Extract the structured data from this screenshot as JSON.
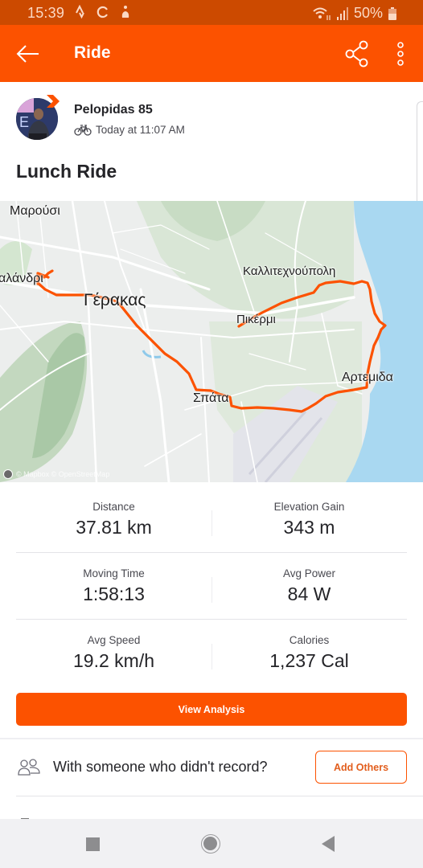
{
  "status_bar": {
    "time": "15:39",
    "battery": "50%",
    "left_icons": [
      "strava-notification-icon",
      "sync-icon",
      "accessibility-icon"
    ],
    "right_icons": [
      "wifi-icon",
      "signal-icon",
      "battery-icon"
    ]
  },
  "app_bar": {
    "title": "Ride",
    "back_icon": "arrow-left-icon",
    "share_icon": "share-icon",
    "more_icon": "more-vertical-icon"
  },
  "activity": {
    "athlete_name": "Pelopidas 85",
    "sport_icon": "bike-icon",
    "timestamp": "Today at 11:07 AM",
    "title": "Lunch Ride"
  },
  "map": {
    "labels": {
      "marousi": "Μαρούσι",
      "chalandri": "αλάνδρι",
      "gerakas": "Γέρακας",
      "kallitechnoupoli": "Καλλιτεχνούπολη",
      "pikermi": "Πικέρμι",
      "spata": "Σπάτα",
      "artemida": "Αρτεμιδα"
    },
    "attribution": "© Mapbox © OpenStreetMap",
    "route_color": "#fc5200",
    "water_color": "#a9d8f1"
  },
  "stats": [
    {
      "label": "Distance",
      "value": "37.81 km"
    },
    {
      "label": "Elevation Gain",
      "value": "343 m"
    },
    {
      "label": "Moving Time",
      "value": "1:58:13"
    },
    {
      "label": "Avg Power",
      "value": "84 W"
    },
    {
      "label": "Avg Speed",
      "value": "19.2 km/h"
    },
    {
      "label": "Calories",
      "value": "1,237 Cal"
    }
  ],
  "actions": {
    "view_analysis": "View Analysis",
    "with_others_text": "With someone who didn't record?",
    "add_others": "Add Others"
  },
  "colors": {
    "brand": "#fc5200",
    "status_bar": "#cc4a00"
  }
}
